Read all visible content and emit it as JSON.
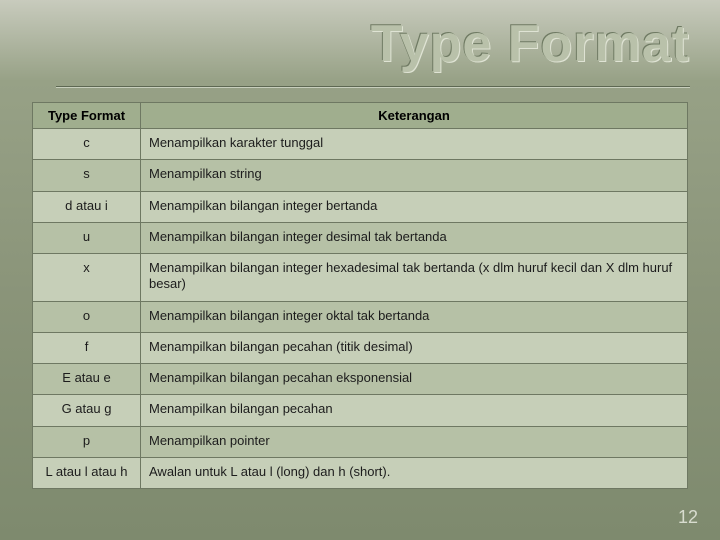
{
  "title": "Type Format",
  "table": {
    "headers": {
      "col1": "Type Format",
      "col2": "Keterangan"
    },
    "rows": [
      {
        "fmt": "c",
        "desc": "Menampilkan karakter tunggal"
      },
      {
        "fmt": "s",
        "desc": "Menampilkan string"
      },
      {
        "fmt": "d atau i",
        "desc": "Menampilkan bilangan integer bertanda"
      },
      {
        "fmt": "u",
        "desc": "Menampilkan bilangan integer desimal tak bertanda"
      },
      {
        "fmt": "x",
        "desc": "Menampilkan bilangan integer hexadesimal tak bertanda (x dlm huruf kecil dan X dlm huruf besar)"
      },
      {
        "fmt": "o",
        "desc": "Menampilkan bilangan integer oktal tak bertanda"
      },
      {
        "fmt": "f",
        "desc": "Menampilkan bilangan pecahan (titik desimal)"
      },
      {
        "fmt": "E atau e",
        "desc": "Menampilkan bilangan pecahan eksponensial"
      },
      {
        "fmt": "G atau g",
        "desc": "Menampilkan bilangan pecahan"
      },
      {
        "fmt": "p",
        "desc": "Menampilkan pointer"
      },
      {
        "fmt": "L atau l atau h",
        "desc": "Awalan untuk L atau l (long) dan h (short)."
      }
    ]
  },
  "page_number": "12"
}
